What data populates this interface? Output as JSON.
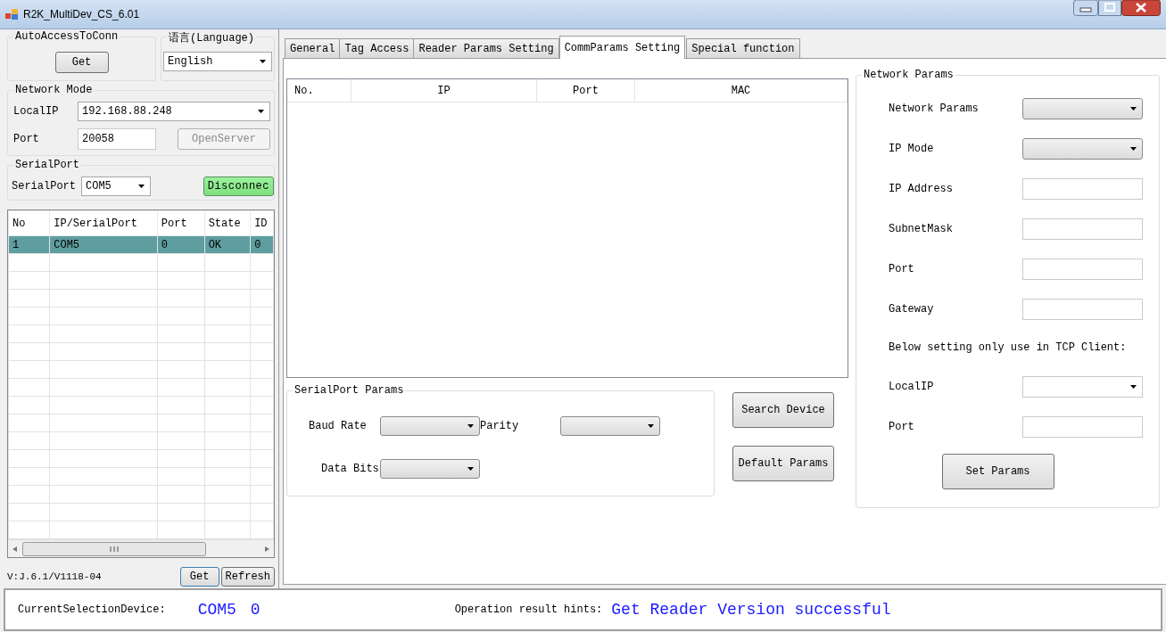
{
  "window": {
    "title": "R2K_MultiDev_CS_6.01"
  },
  "auto_access": {
    "title": "AutoAccessToConn",
    "button": "Get"
  },
  "language": {
    "title": "语言(Language)",
    "value": "English"
  },
  "network_mode": {
    "title": "Network Mode",
    "local_ip_label": "LocalIP",
    "local_ip": "192.168.88.248",
    "port_label": "Port",
    "port": "20058",
    "open_server": {
      "label": "OpenServer",
      "disabled": true
    }
  },
  "serial_port": {
    "title": "SerialPort",
    "label": "SerialPort",
    "value": "COM5",
    "connect_button": "Disconnec"
  },
  "device_table": {
    "columns": [
      "No",
      "IP/SerialPort",
      "Port",
      "State",
      "ID"
    ],
    "rows": [
      {
        "cells": [
          "1",
          "COM5",
          "0",
          "OK",
          "0"
        ],
        "selected": true
      }
    ]
  },
  "version": "V:J.6.1/V1118-04",
  "left_buttons": [
    "Get",
    "Refresh"
  ],
  "tabs": [
    {
      "label": "General",
      "selected": false
    },
    {
      "label": "Tag Access",
      "selected": false
    },
    {
      "label": "Reader Params Setting",
      "selected": false
    },
    {
      "label": "CommParams Setting",
      "selected": true
    },
    {
      "label": "Special function",
      "selected": false
    }
  ],
  "device_list": {
    "columns": [
      "No.",
      "IP",
      "Port",
      "MAC"
    ]
  },
  "serialport_params": {
    "title": "SerialPort Params",
    "fields": [
      {
        "label": "Baud Rate"
      },
      {
        "label": "Parity"
      },
      {
        "label": "Data Bits"
      }
    ]
  },
  "action_buttons": [
    "Search Device",
    "Default Params"
  ],
  "network_params": {
    "title": "Network Params",
    "fields": [
      {
        "kind": "dropdown",
        "label": "Network Params"
      },
      {
        "kind": "dropdown",
        "label": "IP Mode"
      },
      {
        "kind": "text",
        "label": "IP Address"
      },
      {
        "kind": "text",
        "label": "SubnetMask"
      },
      {
        "kind": "text",
        "label": "Port"
      },
      {
        "kind": "text",
        "label": "Gateway"
      },
      {
        "kind": "note",
        "label": "Below setting only use in TCP Client:"
      },
      {
        "kind": "combo",
        "label": "LocalIP"
      },
      {
        "kind": "text",
        "label": "Port"
      }
    ],
    "button": "Set Params"
  },
  "status_bar": {
    "device_label": "CurrentSelectionDevice:",
    "device": "COM5",
    "device_id": "0",
    "hints_label": "Operation result hints:",
    "hint": "Get Reader Version successful"
  }
}
